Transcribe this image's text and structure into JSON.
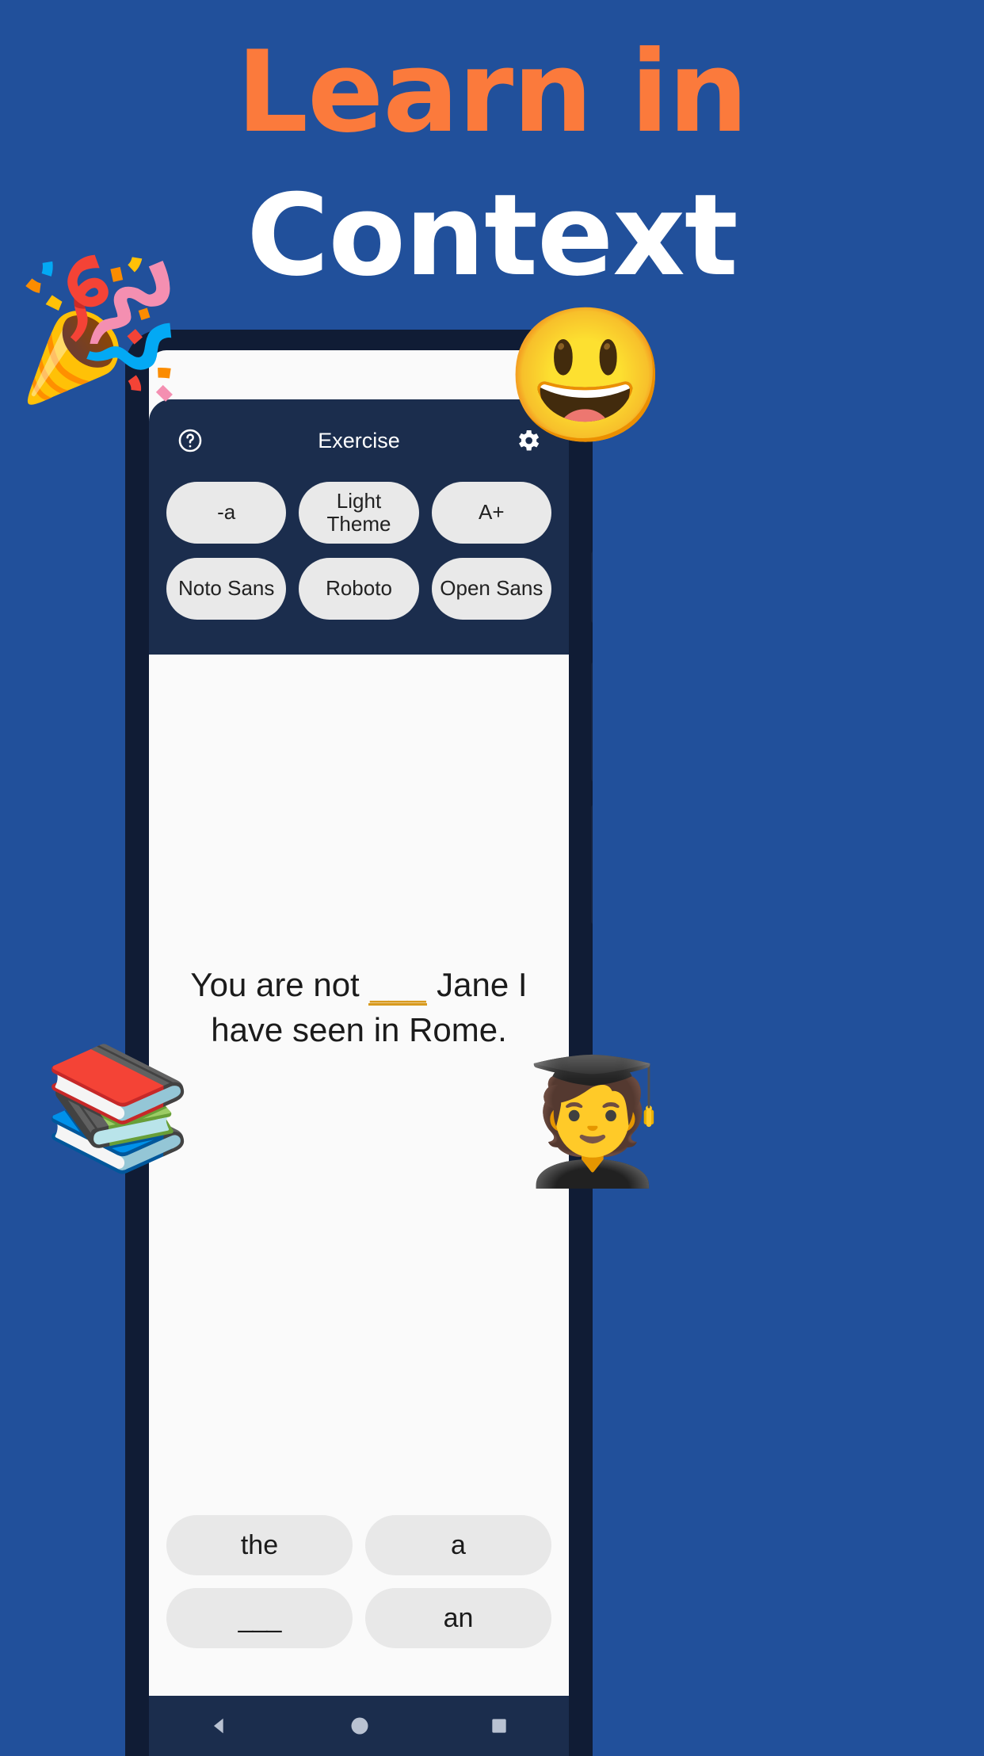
{
  "theme": {
    "background": "#21509b",
    "accent_orange": "#fb7a3c",
    "panel_navy": "#1b2d4d",
    "blank_gold": "#d89a1e",
    "chip_grey": "#e9e9e9"
  },
  "headline": {
    "line1": "Learn in",
    "line2": "Context"
  },
  "app": {
    "header": {
      "help_icon": "help-circle-icon",
      "title": "Exercise",
      "settings_icon": "gear-icon"
    },
    "settings_chips": [
      {
        "label": "-a"
      },
      {
        "label": "Light\nTheme"
      },
      {
        "label": "A+"
      },
      {
        "label": "Noto Sans"
      },
      {
        "label": "Roboto"
      },
      {
        "label": "Open Sans"
      }
    ],
    "question": {
      "before": "You are not ",
      "blank": "___",
      "after": " Jane I have seen in Rome."
    },
    "answers": [
      {
        "label": "the"
      },
      {
        "label": "a"
      },
      {
        "label": "___"
      },
      {
        "label": "an"
      }
    ],
    "navbar": [
      {
        "icon": "back-triangle-icon"
      },
      {
        "icon": "home-circle-icon"
      },
      {
        "icon": "recents-square-icon"
      }
    ]
  },
  "decorations": [
    {
      "name": "party-popper-emoji",
      "glyph": "🎉"
    },
    {
      "name": "grinning-face-emoji",
      "glyph": "😃"
    },
    {
      "name": "books-emoji",
      "glyph": "📚"
    },
    {
      "name": "student-emoji",
      "glyph": "🧑‍🎓"
    }
  ]
}
